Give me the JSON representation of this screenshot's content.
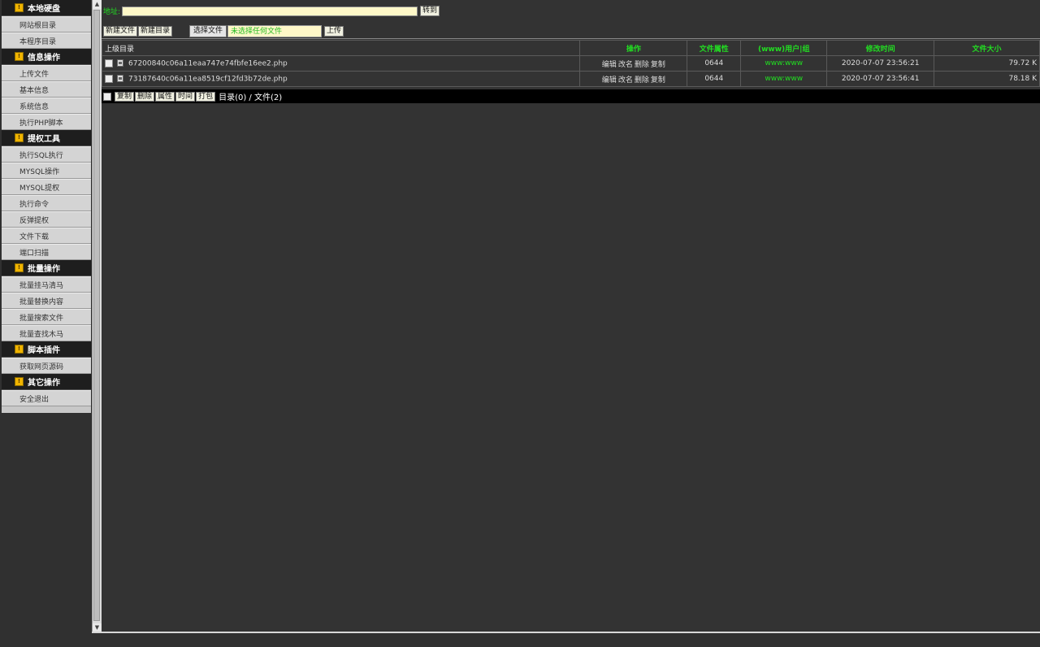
{
  "sidebar": [
    {
      "header": "本地硬盘",
      "items": [
        "网站根目录",
        "本程序目录"
      ]
    },
    {
      "header": "信息操作",
      "items": [
        "上传文件",
        "基本信息",
        "系统信息",
        "执行PHP脚本"
      ]
    },
    {
      "header": "提权工具",
      "items": [
        "执行SQL执行",
        "MYSQL操作",
        "MYSQL提权",
        "执行命令",
        "反弹提权",
        "文件下载",
        "端口扫描"
      ]
    },
    {
      "header": "批量操作",
      "items": [
        "批量挂马清马",
        "批量替换内容",
        "批量搜索文件",
        "批量查找木马"
      ]
    },
    {
      "header": "脚本插件",
      "items": [
        "获取网页源码"
      ]
    },
    {
      "header": "其它操作",
      "items": [
        "安全退出"
      ]
    }
  ],
  "address": {
    "label": "地址:",
    "value": "",
    "go_label": "转到"
  },
  "toolbar": {
    "new_file": "新建文件",
    "new_dir": "新建目录",
    "choose_file": "选择文件",
    "no_file_chosen": "未选择任何文件",
    "upload": "上传"
  },
  "table": {
    "headers": {
      "parent": "上级目录",
      "ops": "操作",
      "perm": "文件属性",
      "owner": "(www)用户|组",
      "mtime": "修改时间",
      "size": "文件大小"
    },
    "rows": [
      {
        "name": "67200840c06a11eaa747e74fbfe16ee2.php",
        "perm": "0644",
        "owner": "www:www",
        "mtime": "2020-07-07 23:56:21",
        "size": "79.72 K"
      },
      {
        "name": "73187640c06a11ea8519cf12fd3b72de.php",
        "perm": "0644",
        "owner": "www:www",
        "mtime": "2020-07-07 23:56:41",
        "size": "78.18 K"
      }
    ],
    "ops": [
      "编辑",
      "改名",
      "删除",
      "复制"
    ]
  },
  "bottom": {
    "buttons": [
      "复制",
      "删除",
      "属性",
      "时间",
      "打包"
    ],
    "summary": "目录(0) / 文件(2)"
  },
  "colors": {
    "accent_green": "#22dd22",
    "panel_bg": "#333333",
    "input_bg": "#fff8c8"
  }
}
